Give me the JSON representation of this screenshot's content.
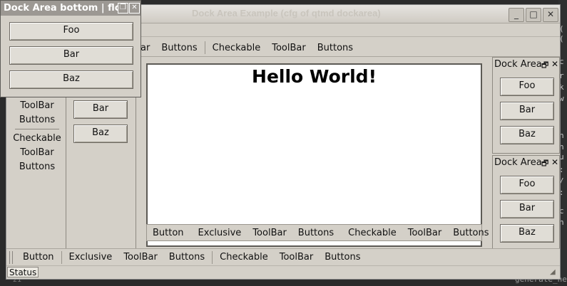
{
  "window": {
    "title": "Dock Area Example (cfg of qtmd dockarea)",
    "controls": {
      "minimize": "_",
      "maximize": "□",
      "close": "✕"
    }
  },
  "background_editor": {
    "side_chars": [
      "(",
      "(",
      "c",
      "r",
      "k",
      "w",
      "h",
      "h",
      "u",
      ":",
      "/",
      ":",
      "c",
      "h"
    ],
    "bottom_text": "generate_he",
    "line_number": "21"
  },
  "float_dock": {
    "title": "Dock Area bottom | float",
    "buttons": [
      "Foo",
      "Bar",
      "Baz"
    ]
  },
  "top_toolbar": {
    "items": [
      "ar",
      "Buttons",
      "Checkable",
      "ToolBar",
      "Buttons"
    ]
  },
  "left_toolbar": {
    "items": [
      "ToolBar",
      "Buttons",
      "Checkable",
      "ToolBar",
      "Buttons"
    ]
  },
  "left_dock": {
    "buttons": [
      "Bar",
      "Baz"
    ]
  },
  "central": {
    "heading": "Hello World!"
  },
  "central_toolbar": {
    "items": [
      "Button",
      "Exclusive",
      "ToolBar",
      "Buttons",
      "Checkable",
      "ToolBar",
      "Buttons"
    ]
  },
  "right_dock_top": {
    "title": "Dock Area",
    "buttons": [
      "Foo",
      "Bar",
      "Baz"
    ]
  },
  "right_dock_bottom": {
    "title": "Dock Area",
    "buttons": [
      "Foo",
      "Bar",
      "Baz"
    ]
  },
  "bottom_toolbar": {
    "items": [
      "Button",
      "Exclusive",
      "ToolBar",
      "Buttons",
      "Checkable",
      "ToolBar",
      "Buttons"
    ]
  },
  "statusbar": {
    "text": "Status"
  }
}
